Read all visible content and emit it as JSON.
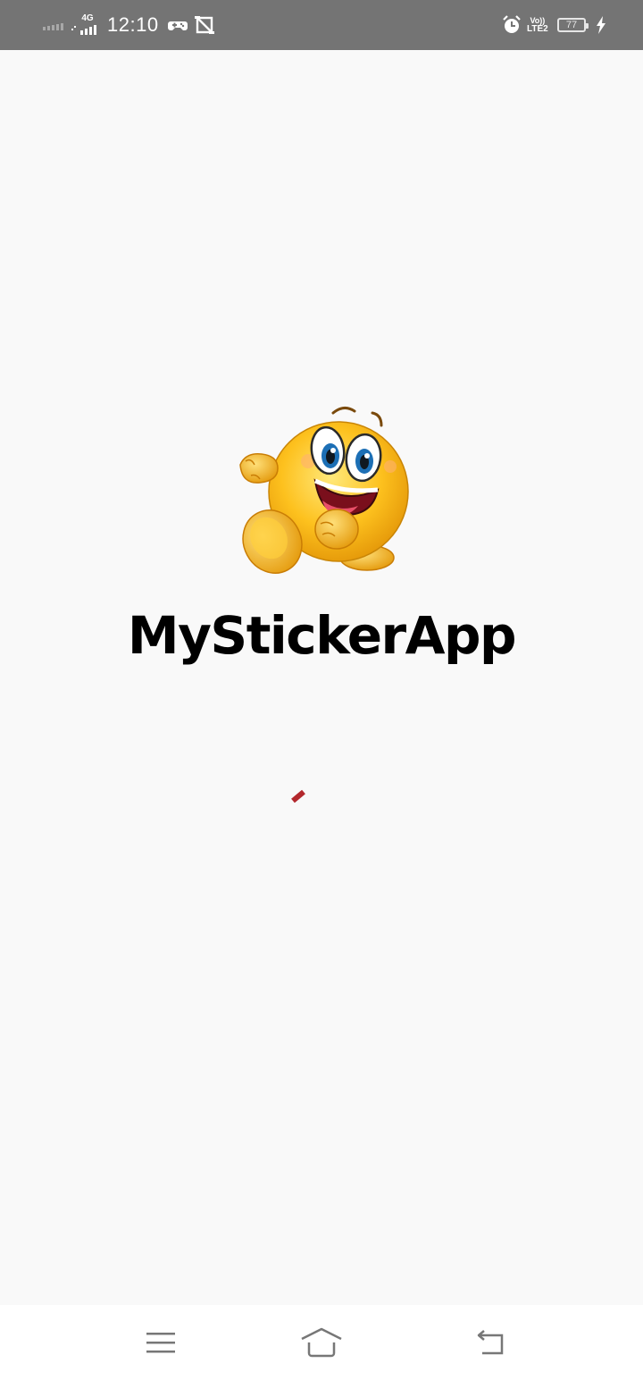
{
  "status_bar": {
    "network_type": "4G",
    "time": "12:10",
    "volte_label": "Vo))",
    "lte_label": "LTE2",
    "battery_level": "77",
    "icons": [
      "signal-icon",
      "signal-4g-icon",
      "game-icon",
      "screenshot-icon",
      "alarm-icon",
      "volte-icon",
      "battery-icon",
      "charging-icon"
    ]
  },
  "splash": {
    "app_name": "MyStickerApp",
    "logo_icon": "smiley-sticker-icon",
    "loading_indicator": "loading-spinner",
    "accent_color": "#b3282d"
  },
  "nav_bar": {
    "buttons": [
      "menu-icon",
      "home-icon",
      "back-icon"
    ]
  },
  "colors": {
    "status_bar_bg": "#747474",
    "page_bg": "#f9f9f9",
    "nav_bar_bg": "#ffffff",
    "nav_icon": "#777777"
  }
}
